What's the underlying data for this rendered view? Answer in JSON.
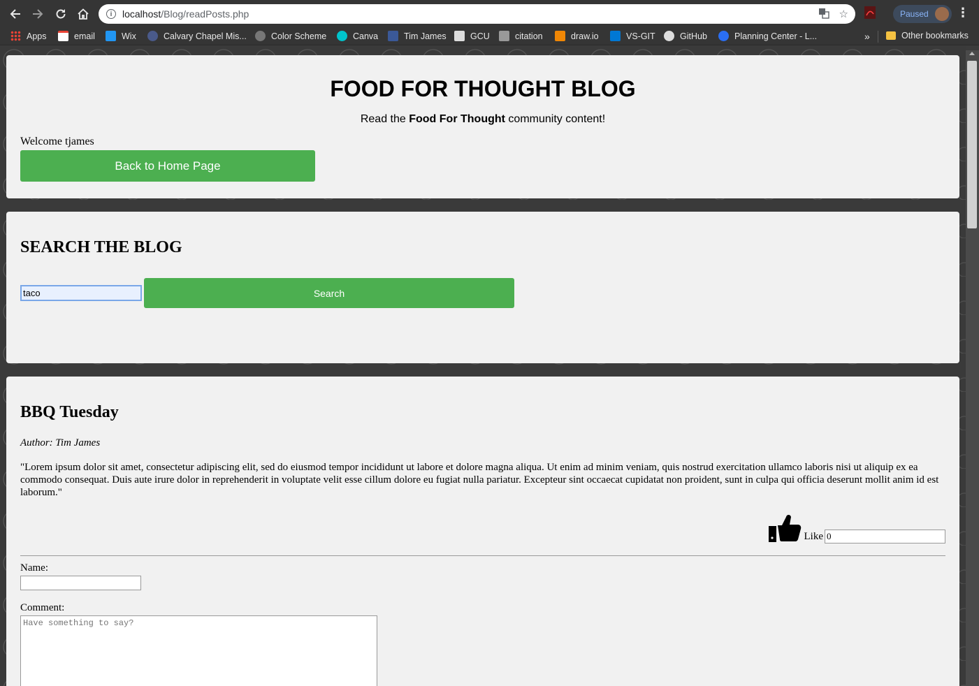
{
  "browser": {
    "url_host": "localhost",
    "url_path": "/Blog/readPosts.php",
    "profile_status": "Paused",
    "bookmarks": [
      {
        "label": "Apps",
        "icon": "apps-grid-icon",
        "color": "#ea4335"
      },
      {
        "label": "email",
        "icon": "gmail-icon",
        "color": "#ea4335"
      },
      {
        "label": "Wix",
        "icon": "wix-icon",
        "color": "#2196f3"
      },
      {
        "label": "Calvary Chapel Mis...",
        "icon": "calvary-icon",
        "color": "#4a5a8a"
      },
      {
        "label": "Color Scheme",
        "icon": "color-scheme-icon",
        "color": "#888888"
      },
      {
        "label": "Canva",
        "icon": "canva-icon",
        "color": "#00c4cc"
      },
      {
        "label": "Tim James",
        "icon": "facebook-icon",
        "color": "#3b5998"
      },
      {
        "label": "GCU",
        "icon": "gcu-icon",
        "color": "#cccccc"
      },
      {
        "label": "citation",
        "icon": "citation-icon",
        "color": "#999999"
      },
      {
        "label": "draw.io",
        "icon": "drawio-icon",
        "color": "#f08705"
      },
      {
        "label": "VS-GIT",
        "icon": "vs-icon",
        "color": "#0078d4"
      },
      {
        "label": "GitHub",
        "icon": "github-icon",
        "color": "#dddddd"
      },
      {
        "label": "Planning Center - L...",
        "icon": "planning-center-icon",
        "color": "#2a6ef2"
      }
    ],
    "overflow_label": "»",
    "other_bookmarks": "Other bookmarks"
  },
  "header": {
    "title": "FOOD FOR THOUGHT BLOG",
    "subtitle_pre": "Read the ",
    "subtitle_bold": "Food For Thought",
    "subtitle_post": " community content!",
    "welcome": "Welcome tjames",
    "home_button": "Back to Home Page"
  },
  "search": {
    "title": "SEARCH THE BLOG",
    "query": "taco",
    "button": "Search"
  },
  "post": {
    "title": "BBQ Tuesday",
    "author": "Author: Tim James",
    "body": "\"Lorem ipsum dolor sit amet, consectetur adipiscing elit, sed do eiusmod tempor incididunt ut labore et dolore magna aliqua. Ut enim ad minim veniam, quis nostrud exercitation ullamco laboris nisi ut aliquip ex ea commodo consequat. Duis aute irure dolor in reprehenderit in voluptate velit esse cillum dolore eu fugiat nulla pariatur. Excepteur sint occaecat cupidatat non proident, sunt in culpa qui officia deserunt mollit anim id est laborum.\"",
    "like_label": "Like",
    "like_count": "0",
    "name_label": "Name:",
    "comment_label": "Comment:",
    "comment_placeholder": "Have something to say?"
  },
  "colors": {
    "accent": "#4caf50",
    "card_bg": "#f1f1f1",
    "page_bg": "#3a3a3a"
  }
}
